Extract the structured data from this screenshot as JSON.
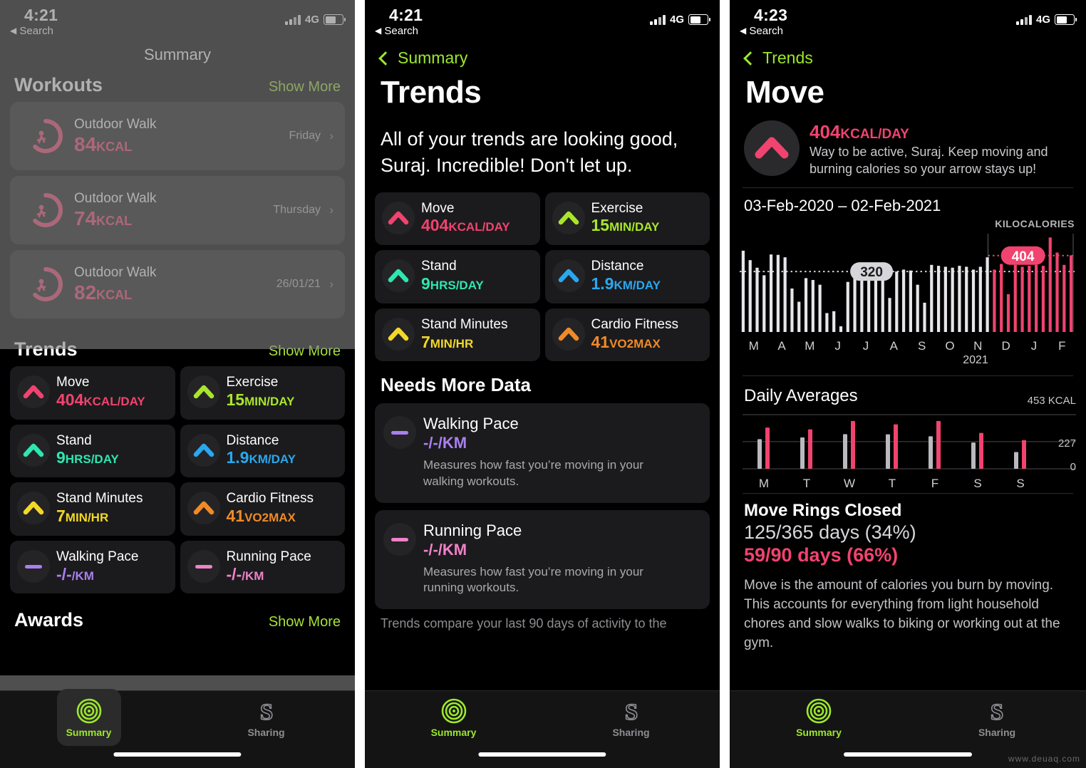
{
  "status_bar": {
    "time_left": "4:21",
    "time_right": "4:23",
    "back_label": "Search",
    "network": "4G",
    "battery_pct": 55
  },
  "panel1": {
    "nav_title": "Summary",
    "workouts": {
      "heading": "Workouts",
      "show_more": "Show More",
      "items": [
        {
          "title": "Outdoor Walk",
          "value": "84",
          "unit": "KCAL",
          "day": "Friday"
        },
        {
          "title": "Outdoor Walk",
          "value": "74",
          "unit": "KCAL",
          "day": "Thursday"
        },
        {
          "title": "Outdoor Walk",
          "value": "82",
          "unit": "KCAL",
          "day": "26/01/21"
        }
      ]
    },
    "trends": {
      "heading": "Trends",
      "show_more": "Show More",
      "cards": [
        {
          "label": "Move",
          "value": "404",
          "unit": "KCAL/DAY",
          "color": "#f1436f",
          "icon": "chevron-up-icon"
        },
        {
          "label": "Exercise",
          "value": "15",
          "unit": "MIN/DAY",
          "color": "#a9e62b",
          "icon": "chevron-up-icon"
        },
        {
          "label": "Stand",
          "value": "9",
          "unit": "HRS/DAY",
          "color": "#2ee6b0",
          "icon": "chevron-up-icon"
        },
        {
          "label": "Distance",
          "value": "1.9",
          "unit": "KM/DAY",
          "color": "#2aa8ef",
          "icon": "chevron-up-icon"
        },
        {
          "label": "Stand Minutes",
          "value": "7",
          "unit": "MIN/HR",
          "color": "#f2d829",
          "icon": "chevron-up-icon"
        },
        {
          "label": "Cardio Fitness",
          "value": "41",
          "unit": "VO2MAX",
          "color": "#f08a28",
          "icon": "chevron-up-icon"
        },
        {
          "label": "Walking Pace",
          "value": "-/-",
          "unit": "/KM",
          "color": "#ab7ff0",
          "icon": "dash-icon"
        },
        {
          "label": "Running Pace",
          "value": "-/-",
          "unit": "/KM",
          "color": "#ef82c8",
          "icon": "dash-icon"
        }
      ]
    },
    "awards": {
      "heading": "Awards",
      "show_more": "Show More"
    }
  },
  "panel2": {
    "back_label": "Summary",
    "title": "Trends",
    "intro": "All of your trends are looking good, Suraj. Incredible! Don't let up.",
    "cards": [
      {
        "label": "Move",
        "value": "404",
        "unit": "KCAL/DAY",
        "color": "#f1436f",
        "icon": "chevron-up-icon"
      },
      {
        "label": "Exercise",
        "value": "15",
        "unit": "MIN/DAY",
        "color": "#a9e62b",
        "icon": "chevron-up-icon"
      },
      {
        "label": "Stand",
        "value": "9",
        "unit": "HRS/DAY",
        "color": "#2ee6b0",
        "icon": "chevron-up-icon"
      },
      {
        "label": "Distance",
        "value": "1.9",
        "unit": "KM/DAY",
        "color": "#2aa8ef",
        "icon": "chevron-up-icon"
      },
      {
        "label": "Stand Minutes",
        "value": "7",
        "unit": "MIN/HR",
        "color": "#f2d829",
        "icon": "chevron-up-icon"
      },
      {
        "label": "Cardio Fitness",
        "value": "41",
        "unit": "VO2MAX",
        "color": "#f08a28",
        "icon": "chevron-up-icon"
      }
    ],
    "needs_more_data": {
      "heading": "Needs More Data",
      "items": [
        {
          "label": "Walking Pace",
          "value": "-/-",
          "unit": "/KM",
          "color": "#ab7ff0",
          "desc": "Measures how fast you’re moving in your walking workouts.",
          "icon": "dash-icon"
        },
        {
          "label": "Running Pace",
          "value": "-/-",
          "unit": "/KM",
          "color": "#ef82c8",
          "desc": "Measures how fast you’re moving in your running workouts.",
          "icon": "dash-icon"
        }
      ],
      "footer_clipped": "Trends compare your last 90 days of activity to the"
    }
  },
  "panel3": {
    "back_label": "Trends",
    "title": "Move",
    "headline_value": "404",
    "headline_unit": "KCAL/DAY",
    "headline_desc": "Way to be active, Suraj. Keep moving and burning calories so your arrow stays up!",
    "date_range": "03-Feb-2020 – 02-Feb-2021",
    "chart_unit_label": "KILOCALORIES",
    "daily_averages_heading": "Daily Averages",
    "avg_top_label": "453 KCAL",
    "avg_mid_label": "227",
    "avg_bot_label": "0",
    "rings_heading": "Move Rings Closed",
    "rings_year": "125/365 days (34%)",
    "rings_90": "59/90 days (66%)",
    "body_text": "Move is the amount of calories you burn by moving. This accounts for everything from light household chores and slow walks to biking or working out at the gym."
  },
  "tabbar": {
    "summary": "Summary",
    "sharing": "Sharing",
    "active": "Summary"
  },
  "watermark": "www.deuaq.com",
  "colors": {
    "accent_green": "#9ce82b",
    "move_pink": "#f1436f",
    "card_bg": "#1b1b1d",
    "page_bg": "#000000"
  },
  "chart_data": [
    {
      "type": "bar",
      "title": "03-Feb-2020 – 02-Feb-2021",
      "ylabel": "KILOCALORIES",
      "xlabel": "",
      "categories": [
        "M",
        "A",
        "M",
        "J",
        "J",
        "A",
        "S",
        "O",
        "N",
        "D",
        "J",
        "F"
      ],
      "tick_note": "Month initials Mar-2020 through Feb-2021; '2021' sublabel under D-J-F",
      "annotations": [
        {
          "label": "320",
          "value": 320,
          "series": "90-day baseline",
          "color": "#d4d4d8"
        },
        {
          "label": "404",
          "value": 404,
          "series": "current 90 days",
          "color": "#f1436f"
        }
      ],
      "series": [
        {
          "name": "Prior period (gray)",
          "color": "#e6e6ea",
          "values": [
            430,
            380,
            340,
            300,
            410,
            408,
            395,
            230,
            160,
            285,
            275,
            250,
            100,
            110,
            30,
            265,
            330,
            335,
            330,
            315,
            290,
            180,
            320,
            330,
            325,
            250,
            155,
            355,
            350,
            345,
            340,
            350,
            345,
            330,
            345,
            395,
            0,
            0,
            0,
            0,
            0,
            0,
            0,
            0,
            0,
            0,
            0,
            0
          ]
        },
        {
          "name": "Current 90 days (pink)",
          "color": "#f1436f",
          "values": [
            0,
            0,
            0,
            0,
            0,
            0,
            0,
            0,
            0,
            0,
            0,
            0,
            0,
            0,
            0,
            0,
            0,
            0,
            0,
            0,
            0,
            0,
            0,
            0,
            0,
            0,
            0,
            0,
            0,
            0,
            0,
            0,
            0,
            0,
            0,
            0,
            330,
            360,
            200,
            355,
            345,
            350,
            355,
            350,
            500,
            420,
            355,
            405
          ]
        }
      ],
      "ylim": [
        0,
        520
      ],
      "grid": "dotted baseline at 320 (gray) and 404 (pink)",
      "legend": "none"
    },
    {
      "type": "bar",
      "title": "Daily Averages",
      "ylabel": "KCAL",
      "categories": [
        "M",
        "T",
        "W",
        "T",
        "F",
        "S",
        "S"
      ],
      "ytick_labels": [
        "453 KCAL",
        "227",
        "0"
      ],
      "ylim": [
        0,
        453
      ],
      "series": [
        {
          "name": "Prior average (gray)",
          "color": "#b9b9be",
          "values": [
            248,
            262,
            290,
            288,
            272,
            220,
            140
          ]
        },
        {
          "name": "Current average (pink)",
          "color": "#f1436f",
          "values": [
            345,
            330,
            400,
            372,
            400,
            300,
            240
          ]
        }
      ],
      "grid": "horizontal lines at 453, 227, 0",
      "legend": "none"
    }
  ]
}
